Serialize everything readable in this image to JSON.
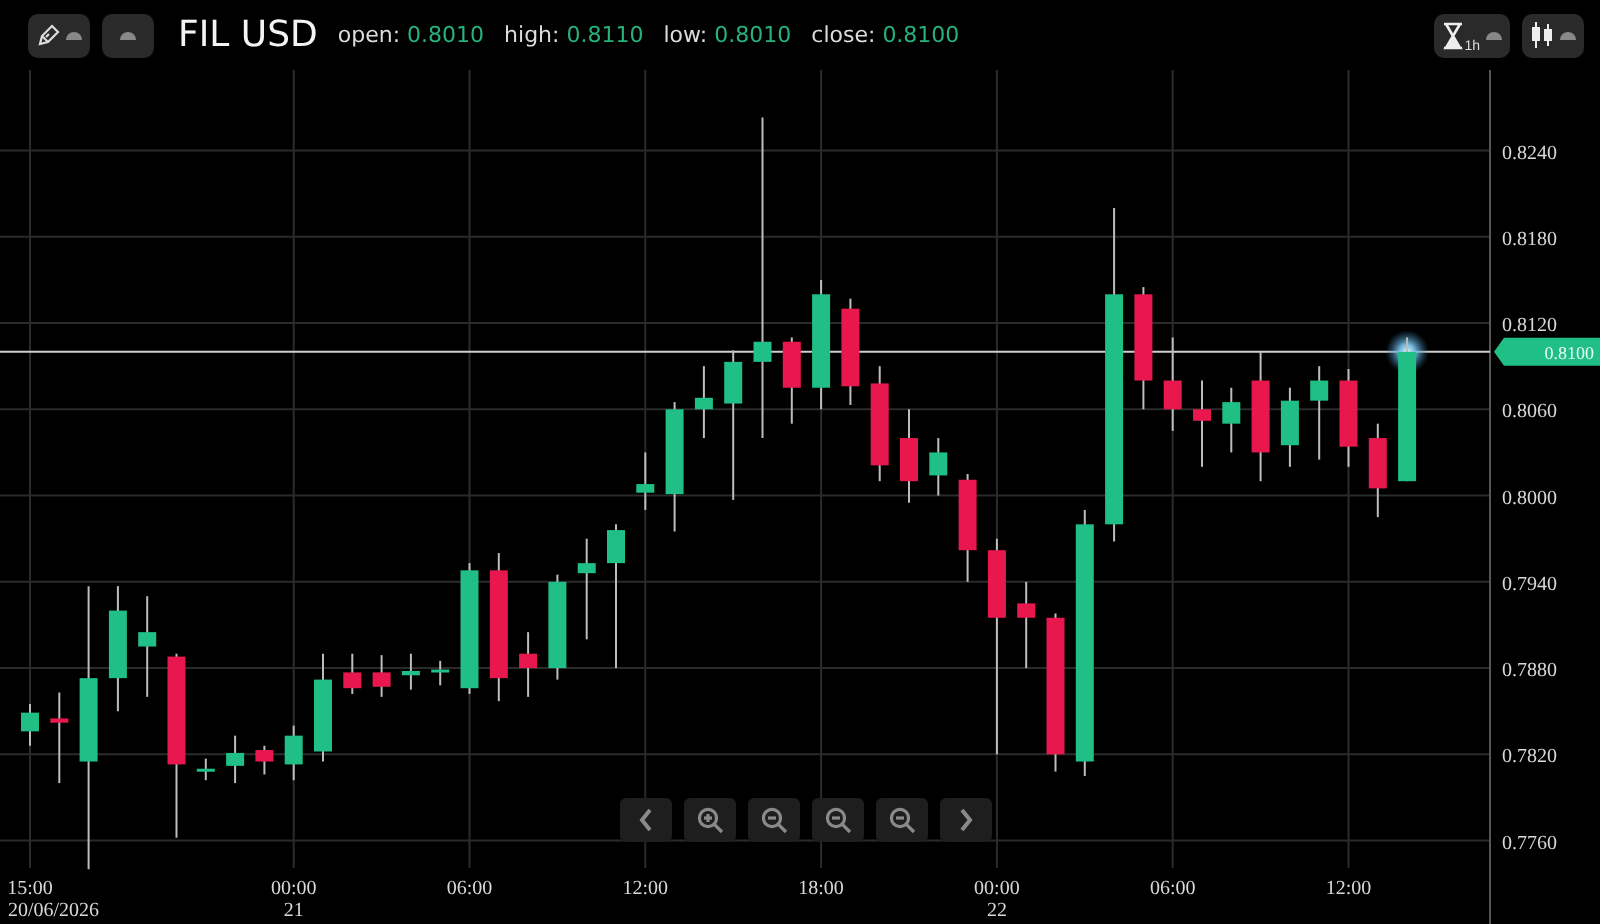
{
  "toolbar": {
    "symbol": "FIL USD",
    "stats": [
      {
        "label": "open:",
        "value": "0.8010"
      },
      {
        "label": "high:",
        "value": "0.8110"
      },
      {
        "label": "low:",
        "value": "0.8010"
      },
      {
        "label": "close:",
        "value": "0.8100"
      }
    ],
    "interval": "1h"
  },
  "chart": {
    "price_tag": "0.8100",
    "date_labels": [
      "20/06/2026",
      "21",
      "22"
    ],
    "chart_data": {
      "type": "candlestick",
      "categories": [
        "15:00",
        null,
        null,
        null,
        null,
        null,
        null,
        null,
        null,
        "00:00",
        null,
        null,
        null,
        null,
        null,
        "06:00",
        null,
        null,
        null,
        null,
        null,
        "12:00",
        null,
        null,
        null,
        null,
        null,
        "18:00",
        null,
        null,
        null,
        null,
        null,
        "00:00",
        null,
        null,
        null,
        null,
        null,
        "06:00",
        null,
        null,
        null,
        null,
        null,
        "12:00",
        null,
        null
      ],
      "ohlc": [
        [
          0.7836,
          0.7855,
          0.7826,
          0.7849
        ],
        [
          0.7845,
          0.7863,
          0.78,
          0.7842
        ],
        [
          0.7815,
          0.7937,
          0.774,
          0.7873
        ],
        [
          0.7873,
          0.7937,
          0.785,
          0.792
        ],
        [
          0.7895,
          0.793,
          0.786,
          0.7905
        ],
        [
          0.7888,
          0.789,
          0.7762,
          0.7813
        ],
        [
          0.7808,
          0.7817,
          0.7802,
          0.781
        ],
        [
          0.7812,
          0.7833,
          0.78,
          0.7821
        ],
        [
          0.7823,
          0.7826,
          0.7806,
          0.7815
        ],
        [
          0.7813,
          0.784,
          0.7802,
          0.7833
        ],
        [
          0.7822,
          0.789,
          0.7815,
          0.7872
        ],
        [
          0.7877,
          0.789,
          0.7862,
          0.7866
        ],
        [
          0.7877,
          0.7889,
          0.786,
          0.7867
        ],
        [
          0.7875,
          0.789,
          0.7865,
          0.7878
        ],
        [
          0.7877,
          0.7885,
          0.7868,
          0.7879
        ],
        [
          0.7866,
          0.7953,
          0.7862,
          0.7948
        ],
        [
          0.7948,
          0.796,
          0.7857,
          0.7873
        ],
        [
          0.789,
          0.7905,
          0.786,
          0.788
        ],
        [
          0.788,
          0.7945,
          0.7872,
          0.794
        ],
        [
          0.7946,
          0.797,
          0.79,
          0.7953
        ],
        [
          0.7953,
          0.798,
          0.788,
          0.7976
        ],
        [
          0.8002,
          0.803,
          0.799,
          0.8008
        ],
        [
          0.8001,
          0.8065,
          0.7975,
          0.806
        ],
        [
          0.806,
          0.809,
          0.804,
          0.8068
        ],
        [
          0.8064,
          0.8101,
          0.7997,
          0.8093
        ],
        [
          0.8093,
          0.8263,
          0.804,
          0.8107
        ],
        [
          0.8107,
          0.811,
          0.805,
          0.8075
        ],
        [
          0.8075,
          0.815,
          0.806,
          0.814
        ],
        [
          0.813,
          0.8137,
          0.8063,
          0.8076
        ],
        [
          0.8078,
          0.809,
          0.801,
          0.8021
        ],
        [
          0.804,
          0.806,
          0.7995,
          0.801
        ],
        [
          0.8014,
          0.804,
          0.8,
          0.803
        ],
        [
          0.8011,
          0.8015,
          0.794,
          0.7962
        ],
        [
          0.7962,
          0.797,
          0.782,
          0.7915
        ],
        [
          0.7925,
          0.794,
          0.788,
          0.7915
        ],
        [
          0.7915,
          0.7918,
          0.7808,
          0.782
        ],
        [
          0.7815,
          0.799,
          0.7805,
          0.798
        ],
        [
          0.798,
          0.82,
          0.7968,
          0.814
        ],
        [
          0.814,
          0.8145,
          0.806,
          0.808
        ],
        [
          0.808,
          0.811,
          0.8045,
          0.806
        ],
        [
          0.806,
          0.808,
          0.802,
          0.8052
        ],
        [
          0.805,
          0.8075,
          0.803,
          0.8065
        ],
        [
          0.808,
          0.81,
          0.801,
          0.803
        ],
        [
          0.8035,
          0.8075,
          0.802,
          0.8066
        ],
        [
          0.8066,
          0.809,
          0.8025,
          0.808
        ],
        [
          0.808,
          0.8088,
          0.802,
          0.8034
        ],
        [
          0.804,
          0.805,
          0.7985,
          0.8005
        ],
        [
          0.801,
          0.811,
          0.801,
          0.81
        ]
      ],
      "yticks": [
        {
          "value": 0.824,
          "label": "0.8240"
        },
        {
          "value": 0.818,
          "label": "0.8180"
        },
        {
          "value": 0.812,
          "label": "0.8120"
        },
        {
          "value": 0.806,
          "label": "0.8060"
        },
        {
          "value": 0.8,
          "label": "0.8000"
        },
        {
          "value": 0.794,
          "label": "0.7940"
        },
        {
          "value": 0.788,
          "label": "0.7880"
        },
        {
          "value": 0.782,
          "label": "0.7820"
        },
        {
          "value": 0.776,
          "label": "0.7760"
        }
      ],
      "ylim": [
        0.7702,
        0.8296
      ],
      "grid": true,
      "ref_lines": [
        {
          "axis": "y",
          "value": 0.81
        }
      ]
    }
  }
}
